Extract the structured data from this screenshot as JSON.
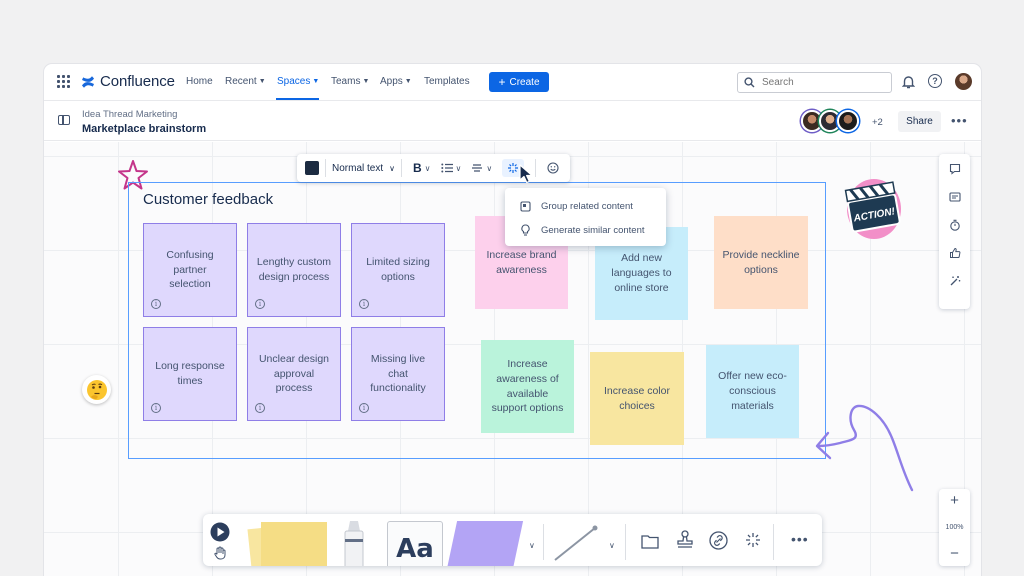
{
  "app": {
    "name": "Confluence",
    "brand_color": "#0c66e4"
  },
  "nav": {
    "items": [
      {
        "label": "Home",
        "dropdown": false
      },
      {
        "label": "Recent",
        "dropdown": true
      },
      {
        "label": "Spaces",
        "dropdown": true,
        "active": true
      },
      {
        "label": "Teams",
        "dropdown": true
      },
      {
        "label": "Apps",
        "dropdown": true
      },
      {
        "label": "Templates",
        "dropdown": false
      }
    ],
    "create_label": "Create",
    "search_placeholder": "Search"
  },
  "page": {
    "breadcrumb": "Idea Thread Marketing",
    "title": "Marketplace brainstorm",
    "collaborators_extra": "+2",
    "share_label": "Share"
  },
  "toolbar": {
    "text_style": "Normal text",
    "bold_label": "B"
  },
  "ai_menu": {
    "items": [
      "Group related content",
      "Generate similar content"
    ]
  },
  "frame": {
    "title": "Customer feedback"
  },
  "stickies": {
    "purple": [
      "Confusing partner selection",
      "Lengthy custom design process",
      "Limited sizing options",
      "Long response times",
      "Unclear design approval process",
      "Missing live chat functionality"
    ],
    "generated": [
      {
        "text": "Increase brand awareness",
        "color": "pink"
      },
      {
        "text": "Add new languages to online store",
        "color": "cyan"
      },
      {
        "text": "Provide neckline options",
        "color": "orange"
      },
      {
        "text": "Increase awareness of available support options",
        "color": "green"
      },
      {
        "text": "Increase color choices",
        "color": "yellow"
      },
      {
        "text": "Offer new eco-conscious materials",
        "color": "cyan"
      }
    ]
  },
  "stickers": {
    "action_text": "ACTION!"
  },
  "zoom": {
    "level": "100%"
  },
  "bottom_toolbar": {
    "text_tool_label": "Aa"
  }
}
